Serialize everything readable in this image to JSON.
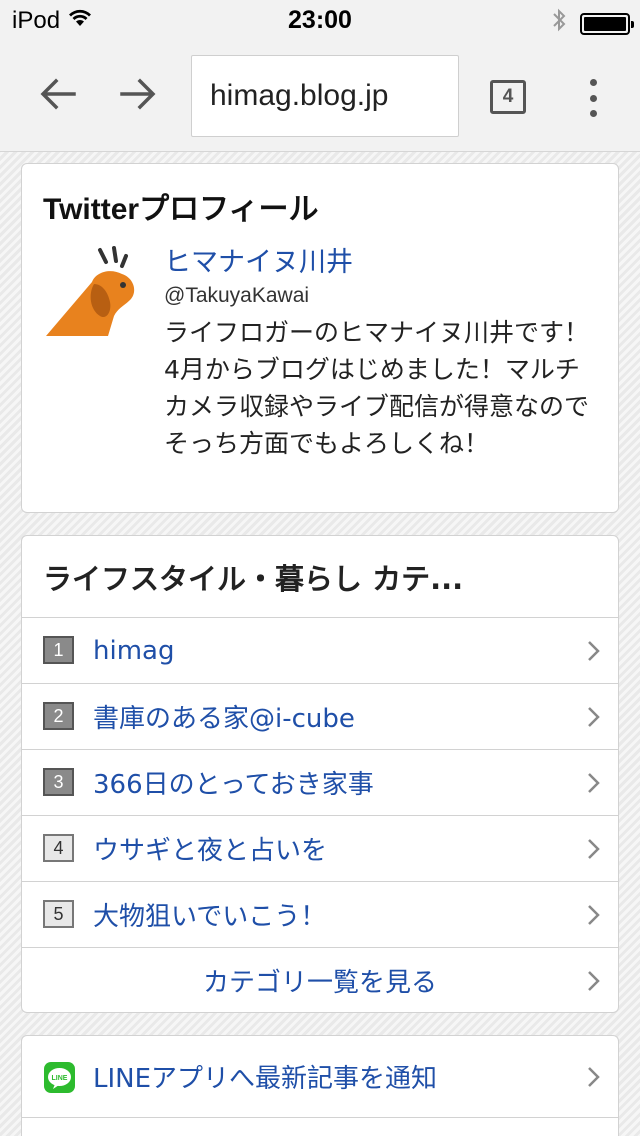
{
  "status_bar": {
    "carrier": "iPod",
    "time": "23:00",
    "wifi_icon": "wifi-icon",
    "bluetooth_icon": "bluetooth-icon",
    "battery_icon": "battery-icon"
  },
  "browser": {
    "url": "himag.blog.jp",
    "tab_count": "4",
    "back_icon": "arrow-left-icon",
    "forward_icon": "arrow-right-icon",
    "menu_icon": "more-vertical-icon"
  },
  "profile": {
    "title": "Twitterプロフィール",
    "name": "ヒマナイヌ川井",
    "handle": "@TakuyaKawai",
    "bio": "ライフロガーのヒマナイヌ川井です！4月からブログはじめました！マルチカメラ収録やライブ配信が得意なのでそっち方面でもよろしくね！",
    "avatar_color": "#e8821e"
  },
  "ranking": {
    "title": "ライフスタイル・暮らし カテ...",
    "items": [
      {
        "rank": "1",
        "label": "himag"
      },
      {
        "rank": "2",
        "label": "書庫のある家@i-cube"
      },
      {
        "rank": "3",
        "label": "366日のとっておき家事"
      },
      {
        "rank": "4",
        "label": "ウサギと夜と占いを"
      },
      {
        "rank": "5",
        "label": "大物狙いでいこう！"
      }
    ],
    "more_label": "カテゴリ一覧を見る"
  },
  "line": {
    "label": "LINEアプリへ最新記事を通知",
    "icon_text": "LINE",
    "icon_color": "#2dbb2e"
  },
  "colors": {
    "link": "#1f4fa8",
    "toolbar": "#f2f2f2"
  }
}
